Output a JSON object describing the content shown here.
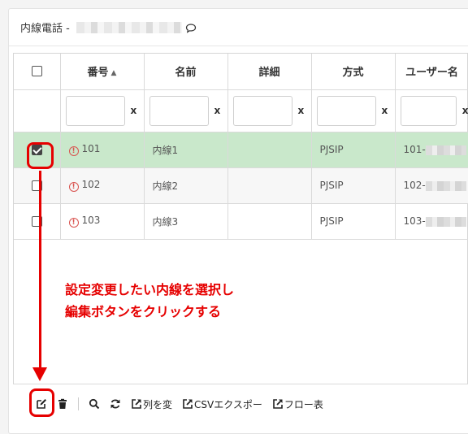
{
  "header": {
    "title": "内線電話 -"
  },
  "columns": [
    "番号",
    "名前",
    "詳細",
    "方式",
    "ユーザー名"
  ],
  "filter_clear": "x",
  "rows": [
    {
      "number": "101",
      "name": "内線1",
      "detail": "",
      "method": "PJSIP",
      "user": "101-",
      "selected": true
    },
    {
      "number": "102",
      "name": "内線2",
      "detail": "",
      "method": "PJSIP",
      "user": "102-",
      "selected": false
    },
    {
      "number": "103",
      "name": "内線3",
      "detail": "",
      "method": "PJSIP",
      "user": "103-",
      "selected": false
    }
  ],
  "annotation": {
    "line1": "設定変更したい内線を選択し",
    "line2": "編集ボタンをクリックする",
    "color": "#e60000"
  },
  "toolbar": {
    "columns_label": "列を変",
    "csv_label": "CSVエクスポー",
    "flow_label": "フロー表"
  },
  "colors": {
    "selected_row": "#c9e8cb",
    "warning": "#d9534f"
  }
}
